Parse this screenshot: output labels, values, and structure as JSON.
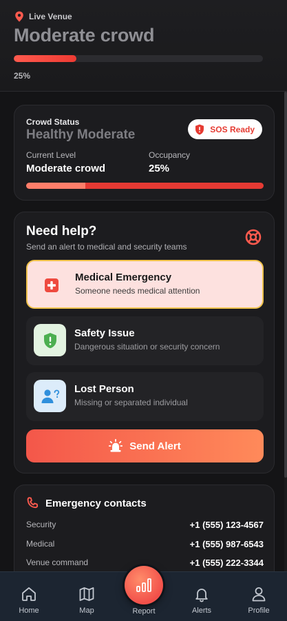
{
  "header": {
    "venue_label": "Live Venue",
    "title": "Moderate crowd",
    "progress_percent": 25,
    "progress_text": "25%"
  },
  "status_card": {
    "label": "Crowd Status",
    "value": "Healthy Moderate",
    "sos_label": "SOS Ready",
    "current_level_label": "Current Level",
    "current_level_value": "Moderate crowd",
    "occupancy_label": "Occupancy",
    "occupancy_value": "25%",
    "occupancy_percent": 25
  },
  "help": {
    "title": "Need help?",
    "subtitle": "Send an alert to medical and security teams",
    "options": [
      {
        "title": "Medical Emergency",
        "description": "Someone needs medical attention",
        "icon": "medical-cross-icon",
        "selected": true
      },
      {
        "title": "Safety Issue",
        "description": "Dangerous situation or security concern",
        "icon": "shield-alert-icon",
        "selected": false
      },
      {
        "title": "Lost Person",
        "description": "Missing or separated individual",
        "icon": "person-question-icon",
        "selected": false
      }
    ],
    "send_label": "Send Alert"
  },
  "contacts": {
    "title": "Emergency contacts",
    "items": [
      {
        "name": "Security",
        "number": "+1 (555) 123-4567"
      },
      {
        "name": "Medical",
        "number": "+1 (555) 987-6543"
      },
      {
        "name": "Venue command",
        "number": "+1 (555) 222-3344"
      }
    ]
  },
  "nav": {
    "items": [
      {
        "label": "Home",
        "icon": "home-icon"
      },
      {
        "label": "Map",
        "icon": "map-icon"
      },
      {
        "label": "Report",
        "icon": "bar-chart-icon"
      },
      {
        "label": "Alerts",
        "icon": "bell-icon"
      },
      {
        "label": "Profile",
        "icon": "user-icon"
      }
    ]
  },
  "colors": {
    "accent": "#f4574a",
    "selected_border": "#f0c24b",
    "background": "#141416",
    "nav_background": "#1c2531"
  }
}
